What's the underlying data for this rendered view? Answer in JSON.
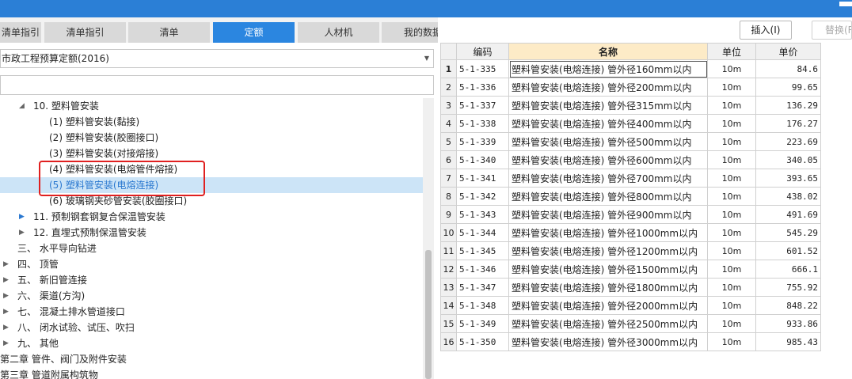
{
  "tabs": [
    {
      "label": "清单指引",
      "active": false
    },
    {
      "label": "清单指引",
      "active": false
    },
    {
      "label": "清单",
      "active": false
    },
    {
      "label": "定额",
      "active": true
    },
    {
      "label": "人材机",
      "active": false
    },
    {
      "label": "我的数据",
      "active": false
    }
  ],
  "quota_library": {
    "selected": "市政工程预算定额(2016)"
  },
  "search": {
    "value": ""
  },
  "tree": [
    {
      "toggle": "◢",
      "text": "10. 塑料管安装",
      "selected": false
    },
    {
      "toggle": "",
      "text": "(1) 塑料管安装(黏接)",
      "selected": false
    },
    {
      "toggle": "",
      "text": "(2) 塑料管安装(胶圈接口)",
      "selected": false
    },
    {
      "toggle": "",
      "text": "(3) 塑料管安装(对接熔接)",
      "selected": false
    },
    {
      "toggle": "",
      "text": "(4) 塑料管安装(电熔管件熔接)",
      "selected": false
    },
    {
      "toggle": "",
      "text": "(5) 塑料管安装(电熔连接)",
      "selected": true
    },
    {
      "toggle": "",
      "text": "(6) 玻璃钢夹砂管安装(胶圈接口)",
      "selected": false
    },
    {
      "toggle": "▶",
      "text": "11. 预制钢套钢复合保温管安装",
      "selected": false
    },
    {
      "toggle": "▶",
      "text": "12. 直埋式预制保温管安装",
      "selected": false
    },
    {
      "toggle": "",
      "text": "三、 水平导向钻进",
      "selected": false
    },
    {
      "toggle": "▶",
      "text": "四、 顶管",
      "selected": false
    },
    {
      "toggle": "▶",
      "text": "五、 新旧管连接",
      "selected": false
    },
    {
      "toggle": "▶",
      "text": "六、 渠道(方沟)",
      "selected": false
    },
    {
      "toggle": "▶",
      "text": "七、 混凝土排水管道接口",
      "selected": false
    },
    {
      "toggle": "▶",
      "text": "八、 闭水试验、试压、吹扫",
      "selected": false
    },
    {
      "toggle": "▶",
      "text": "九、 其他",
      "selected": false
    },
    {
      "toggle": "",
      "text": "第二章 管件、阀门及附件安装",
      "selected": false
    },
    {
      "toggle": "",
      "text": "第三章 管道附属构筑物",
      "selected": false
    }
  ],
  "buttons": {
    "insert": "插入(I)",
    "replace": "替换(R)"
  },
  "grid": {
    "headers": [
      "编码",
      "名称",
      "单位",
      "单价"
    ],
    "rows": [
      {
        "no": "1",
        "code": "5-1-335",
        "name": "塑料管安装(电熔连接) 管外径160mm以内",
        "unit": "10m",
        "price": "84.6"
      },
      {
        "no": "2",
        "code": "5-1-336",
        "name": "塑料管安装(电熔连接) 管外径200mm以内",
        "unit": "10m",
        "price": "99.65"
      },
      {
        "no": "3",
        "code": "5-1-337",
        "name": "塑料管安装(电熔连接) 管外径315mm以内",
        "unit": "10m",
        "price": "136.29"
      },
      {
        "no": "4",
        "code": "5-1-338",
        "name": "塑料管安装(电熔连接) 管外径400mm以内",
        "unit": "10m",
        "price": "176.27"
      },
      {
        "no": "5",
        "code": "5-1-339",
        "name": "塑料管安装(电熔连接) 管外径500mm以内",
        "unit": "10m",
        "price": "223.69"
      },
      {
        "no": "6",
        "code": "5-1-340",
        "name": "塑料管安装(电熔连接) 管外径600mm以内",
        "unit": "10m",
        "price": "340.05"
      },
      {
        "no": "7",
        "code": "5-1-341",
        "name": "塑料管安装(电熔连接) 管外径700mm以内",
        "unit": "10m",
        "price": "393.65"
      },
      {
        "no": "8",
        "code": "5-1-342",
        "name": "塑料管安装(电熔连接) 管外径800mm以内",
        "unit": "10m",
        "price": "438.02"
      },
      {
        "no": "9",
        "code": "5-1-343",
        "name": "塑料管安装(电熔连接) 管外径900mm以内",
        "unit": "10m",
        "price": "491.69"
      },
      {
        "no": "10",
        "code": "5-1-344",
        "name": "塑料管安装(电熔连接) 管外径1000mm以内",
        "unit": "10m",
        "price": "545.29"
      },
      {
        "no": "11",
        "code": "5-1-345",
        "name": "塑料管安装(电熔连接) 管外径1200mm以内",
        "unit": "10m",
        "price": "601.52"
      },
      {
        "no": "12",
        "code": "5-1-346",
        "name": "塑料管安装(电熔连接) 管外径1500mm以内",
        "unit": "10m",
        "price": "666.1"
      },
      {
        "no": "13",
        "code": "5-1-347",
        "name": "塑料管安装(电熔连接) 管外径1800mm以内",
        "unit": "10m",
        "price": "755.92"
      },
      {
        "no": "14",
        "code": "5-1-348",
        "name": "塑料管安装(电熔连接) 管外径2000mm以内",
        "unit": "10m",
        "price": "848.22"
      },
      {
        "no": "15",
        "code": "5-1-349",
        "name": "塑料管安装(电熔连接) 管外径2500mm以内",
        "unit": "10m",
        "price": "933.86"
      },
      {
        "no": "16",
        "code": "5-1-350",
        "name": "塑料管安装(电熔连接) 管外径3000mm以内",
        "unit": "10m",
        "price": "985.43"
      }
    ]
  },
  "colors": {
    "accent": "#2b86e0",
    "highlight_box": "#e02020",
    "selected_row": "#cce4f7",
    "name_header": "#fdebc7"
  },
  "icons": {
    "dropdown": "chevron-down-icon",
    "expand": "triangle-right-icon",
    "collapse": "triangle-down-icon"
  }
}
